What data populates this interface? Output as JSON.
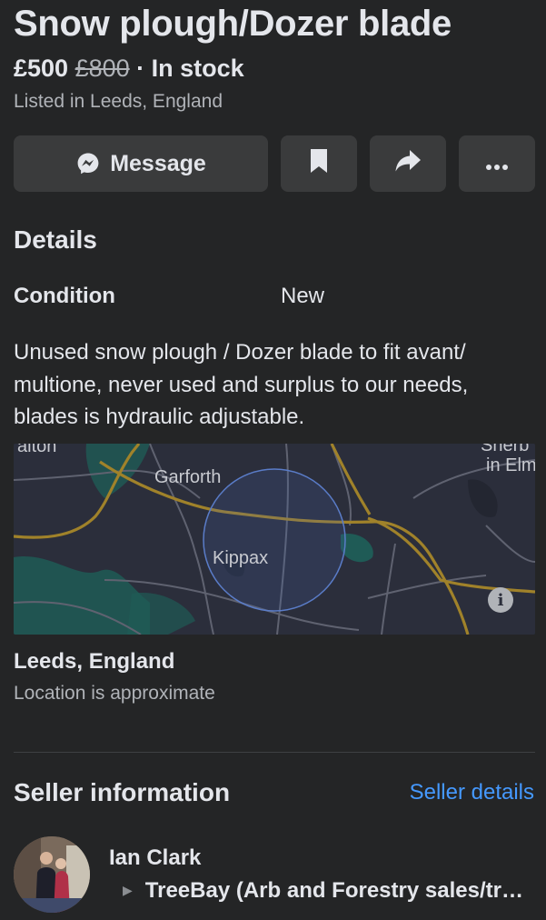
{
  "listing": {
    "title": "Snow plough/Dozer blade",
    "price": "£500",
    "old_price": "£800",
    "separator": " · ",
    "availability": "In stock",
    "location_line": "Listed in Leeds, England"
  },
  "actions": {
    "message_label": "Message",
    "message_icon": "messenger-icon",
    "save_icon": "bookmark-icon",
    "share_icon": "share-arrow-icon",
    "more_icon": "more-dots-icon"
  },
  "details": {
    "heading": "Details",
    "condition_label": "Condition",
    "condition_value": "New",
    "description": "Unused snow plough / Dozer blade to fit avant/ multione, never used and surplus to our needs, blades is hydraulic adjustable."
  },
  "map": {
    "labels": {
      "garforth": "Garforth",
      "kippax": "Kippax",
      "alton": "alton",
      "sherburn_top": "Sherb",
      "sherburn_bottom": "in Elm"
    },
    "info_glyph": "i",
    "colors": {
      "background": "#2b2e3b",
      "major_road": "#a0822a",
      "minor_road": "#5f6270",
      "green": "#1f5b56",
      "radius": "#5a7cc8"
    }
  },
  "location": {
    "title": "Leeds, England",
    "subtitle": "Location is approximate"
  },
  "seller": {
    "heading": "Seller information",
    "details_link": "Seller details",
    "name": "Ian Clark",
    "group": "TreeBay (Arb and Forestry sales/trade)",
    "group_arrow": "▶"
  }
}
